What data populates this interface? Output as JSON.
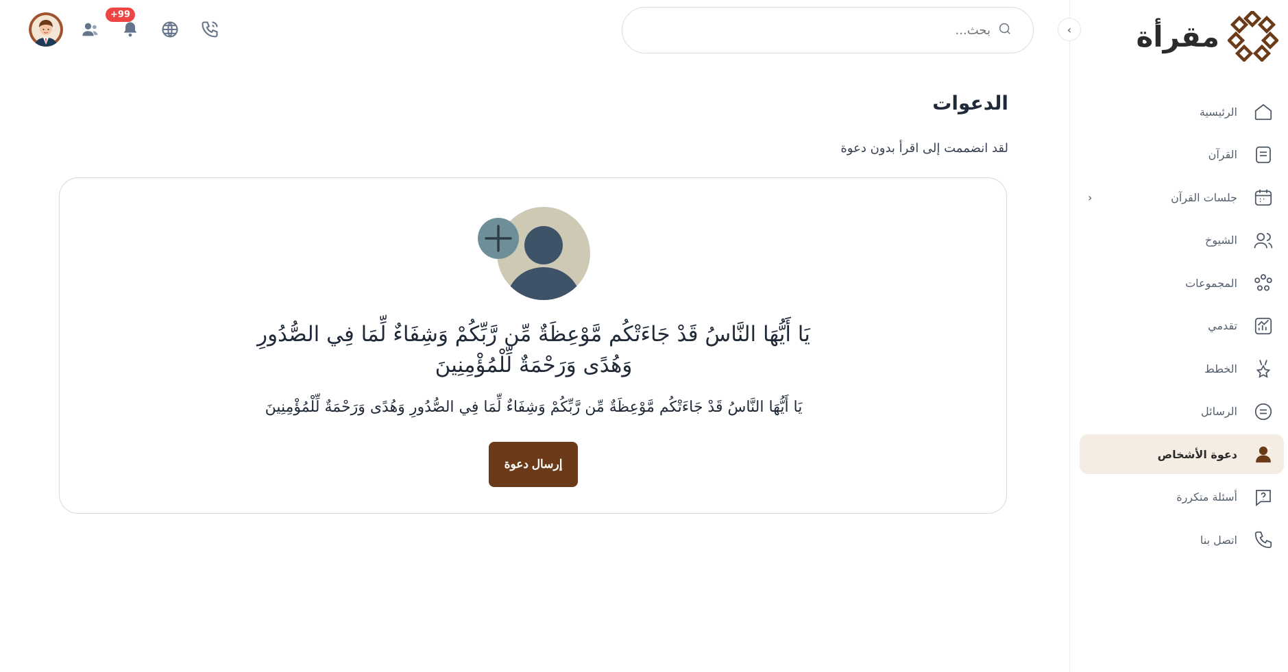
{
  "brand": {
    "name": "مقرأة",
    "color": "#6b3a19"
  },
  "search": {
    "placeholder": "بحث..."
  },
  "header": {
    "notifications_badge": "+99"
  },
  "sidebar": {
    "items": [
      {
        "label": "الرئيسية",
        "icon": "home-icon"
      },
      {
        "label": "القرآن",
        "icon": "book-icon"
      },
      {
        "label": "جلسات القرآن",
        "icon": "calendar-icon",
        "has_submenu": true
      },
      {
        "label": "الشيوخ",
        "icon": "users-icon"
      },
      {
        "label": "المجموعات",
        "icon": "groups-icon"
      },
      {
        "label": "تقدمي",
        "icon": "chart-icon"
      },
      {
        "label": "الخطط",
        "icon": "medal-icon"
      },
      {
        "label": "الرسائل",
        "icon": "message-icon"
      },
      {
        "label": "دعوة الأشخاص",
        "icon": "user-plus-icon",
        "active": true
      },
      {
        "label": "أسئلة متكررة",
        "icon": "question-icon"
      },
      {
        "label": "اتصل بنا",
        "icon": "phone-icon"
      }
    ]
  },
  "main": {
    "title": "الدعوات",
    "subtitle": "لقد انضممت إلى اقرأ بدون دعوة",
    "verse_large": "يَا أَيُّهَا النَّاسُ قَدْ جَاءَتْكُم مَّوْعِظَةٌ مِّن رَّبِّكُمْ وَشِفَاءٌ لِّمَا فِي الصُّدُورِ وَهُدًى وَرَحْمَةٌ لِّلْمُؤْمِنِينَ",
    "verse_small": "يَا أَيُّهَا النَّاسُ قَدْ جَاءَتْكُم مَّوْعِظَةٌ مِّن رَّبِّكُمْ وَشِفَاءٌ لِّمَا فِي الصُّدُورِ وَهُدًى وَرَحْمَةٌ لِّلْمُؤْمِنِينَ",
    "send_invite_label": "إرسال دعوة"
  }
}
